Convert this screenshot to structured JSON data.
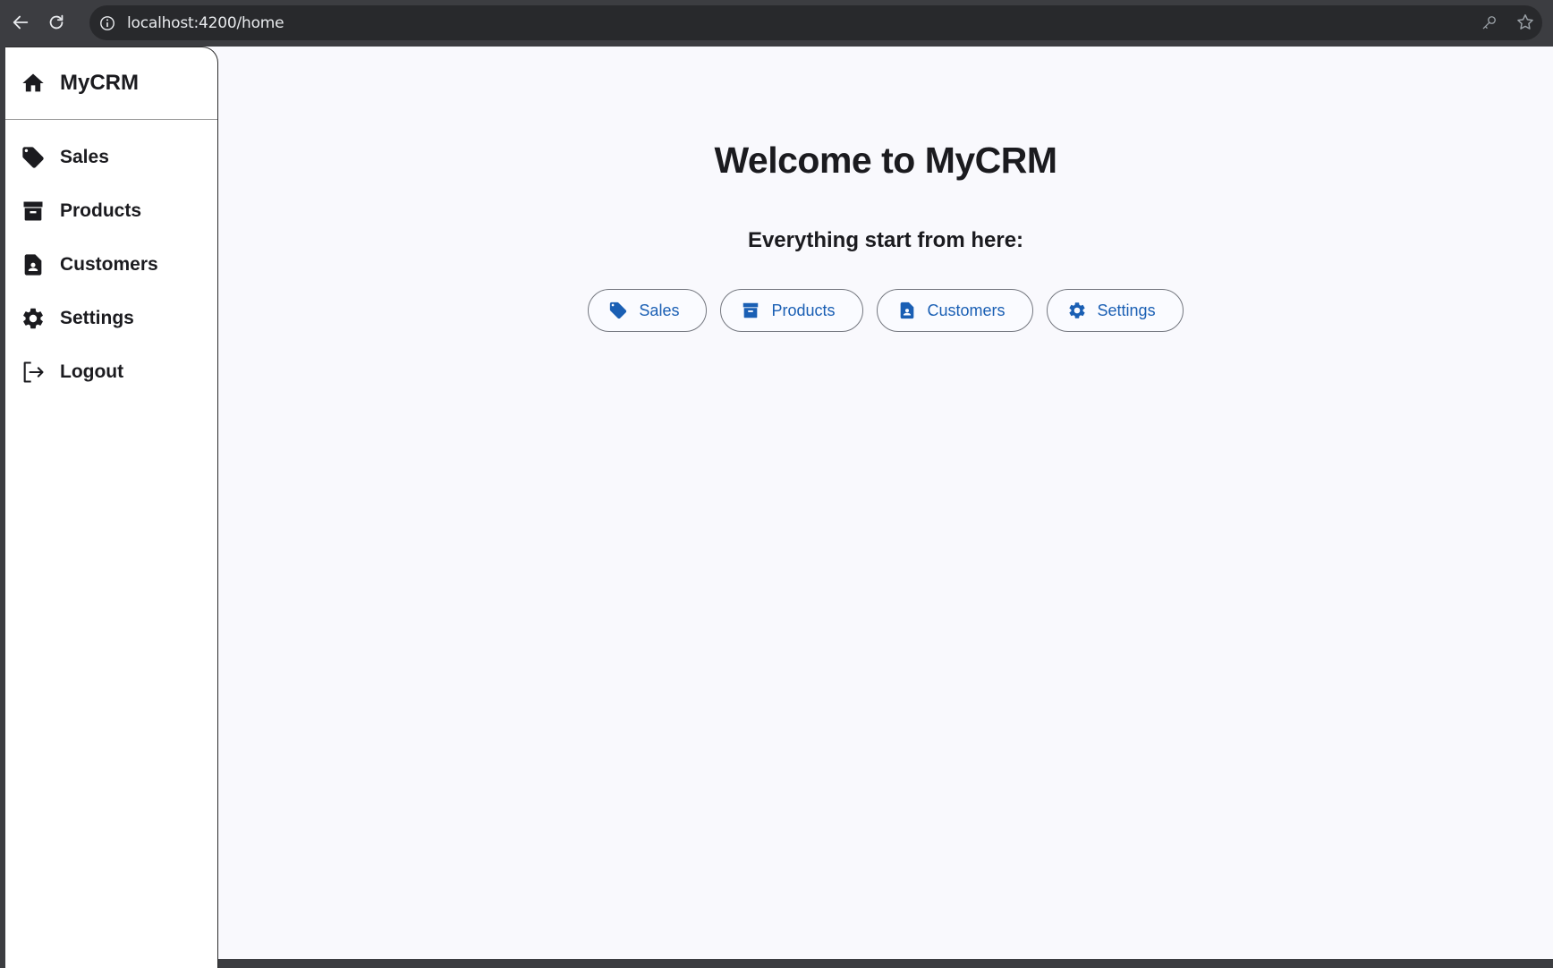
{
  "browser": {
    "url": "localhost:4200/home"
  },
  "sidebar": {
    "brand": {
      "label": "MyCRM",
      "icon": "home-icon"
    },
    "items": [
      {
        "label": "Sales",
        "icon": "tag-icon"
      },
      {
        "label": "Products",
        "icon": "archive-box-icon"
      },
      {
        "label": "Customers",
        "icon": "contact-file-icon"
      },
      {
        "label": "Settings",
        "icon": "gear-icon"
      },
      {
        "label": "Logout",
        "icon": "logout-icon"
      }
    ]
  },
  "main": {
    "title": "Welcome to MyCRM",
    "subtitle": "Everything start from here:",
    "actions": [
      {
        "label": "Sales",
        "icon": "tag-icon"
      },
      {
        "label": "Products",
        "icon": "archive-box-icon"
      },
      {
        "label": "Customers",
        "icon": "contact-file-icon"
      },
      {
        "label": "Settings",
        "icon": "gear-icon"
      }
    ]
  },
  "colors": {
    "accent": "#1a5fb4",
    "text": "#1b1b1f",
    "page_background": "#f9f9fd",
    "browser_chrome": "#3c3d41"
  }
}
